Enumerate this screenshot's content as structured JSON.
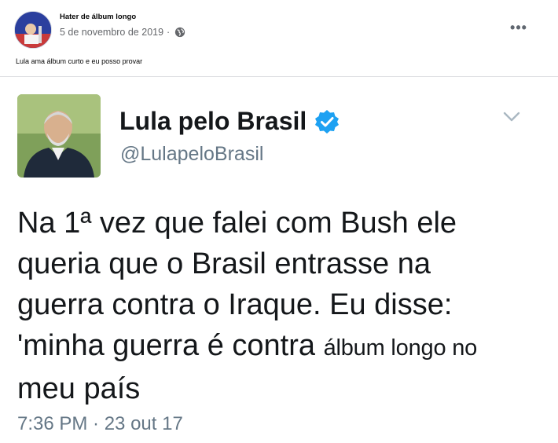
{
  "post": {
    "author": "Hater de álbum longo",
    "date": "5 de novembro de 2019",
    "separator": "·",
    "privacy_icon": "globe-icon",
    "more_icon": "more-options-icon",
    "more_label": "•••",
    "text": "Lula ama álbum curto e eu posso provar"
  },
  "tweet": {
    "display_name": "Lula pelo Brasil",
    "verified_icon": "verified-badge-icon",
    "handle": "@LulapeloBrasil",
    "menu_icon": "chevron-down-icon",
    "body_lines": [
      "Na 1ª vez que falei com Bush ele",
      "queria que o Brasil entrasse na",
      "guerra contra o Iraque. Eu disse:",
      "'minha guerra é contra "
    ],
    "body_edited_part": "álbum longo no",
    "body_last_line": "meu país",
    "time": "7:36 PM · 23 out 17"
  },
  "colors": {
    "verified": "#1da1f2",
    "secondary_text": "#657786",
    "primary_text": "#14171a"
  }
}
